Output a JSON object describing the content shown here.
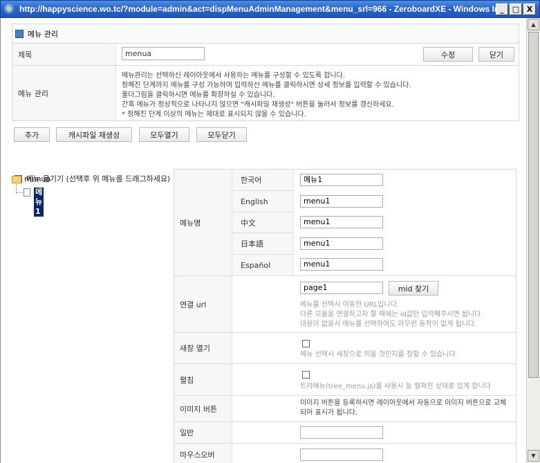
{
  "window": {
    "title": "http://happyscience.wo.tc/?module=admin&act=dispMenuAdminManagement&menu_srl=966 - ZeroboardXE - Windows Internet Explo...",
    "min": "_",
    "max": "□",
    "close": "X"
  },
  "panel": {
    "title": "메뉴 관리",
    "title_label": "제목",
    "title_value": "menua",
    "edit_button": "수정",
    "close_button": "닫기",
    "desc_label": "메뉴 관리",
    "desc_lines": [
      "메뉴관리는 선택하신 레이아웃에서 사용하는 메뉴를 구성할 수 있도록 합니다.",
      "정해진 단계까지 메뉴를 구성 가능하며 입력하신 메뉴를 클릭하시면 상세 정보를 입력할 수 있습니다.",
      "폴더그림을 클릭하시면 메뉴를 확장하실 수 있습니다.",
      "간혹 메뉴가 정상적으로 나타나지 않으면 \"캐시파일 재생성\" 버튼을 눌러서 정보를 갱신하세요.",
      "* 정해진 단계 이상의 메뉴는 제대로 표시되지 않을 수 있습니다."
    ]
  },
  "actions": {
    "add": "추가",
    "regen_cache": "캐시파일 재생성",
    "expand_all": "모두열기",
    "collapse_all": "모두닫기"
  },
  "move_menu_label": "메뉴 옮기기 (선택후 위 메뉴를 드래그하세요)",
  "tree": {
    "root": "menua",
    "child": "메뉴1"
  },
  "detail": {
    "menu_name_label": "메뉴명",
    "languages": [
      {
        "lang": "한국어",
        "value": "메뉴1"
      },
      {
        "lang": "English",
        "value": "menu1"
      },
      {
        "lang": "中文",
        "value": "menu1"
      },
      {
        "lang": "日本語",
        "value": "menu1"
      },
      {
        "lang": "Español",
        "value": "menu1"
      }
    ],
    "url_label": "연결 url",
    "url_value": "page1",
    "mid_find_button": "mid 찾기",
    "url_help": "메뉴를 선택시 이동한 URL입니다.\n다른 모듈을 연결하고자 할 때에는 id값만 입력해주시면 됩니다.\n내용이 없을시 메뉴를 선택하여도 아무런 동작이 없게 됩니다.",
    "new_window_label": "새창 열기",
    "new_window_help": "메뉴 선택시 새창으로 띄울 것인지를 정할 수 있습니다",
    "expand_label": "펼침",
    "expand_help": "트리메뉴(tree_menu.js)를 사용시 늘 펼쳐진 상태로 있게 합니다",
    "image_button_label": "이미지 버튼",
    "image_button_help": "이미지 버튼을 등록하시면 레이아웃에서 자동으로 이미지 버튼으로 교체되어 표시가 됩니다.",
    "normal_label": "일반",
    "mouseover_label": "마우스오버"
  }
}
